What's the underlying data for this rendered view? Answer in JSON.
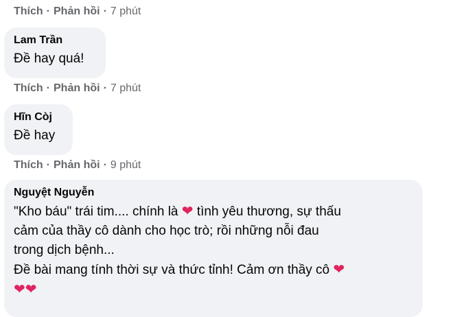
{
  "comments": [
    {
      "actions": {
        "like": "Thích",
        "reply": "Phản hồi",
        "time": "7 phút"
      }
    },
    {
      "author": "Lam Trần",
      "lines": [
        "Đề hay quá!"
      ],
      "actions": {
        "like": "Thích",
        "reply": "Phản hồi",
        "time": "7 phút"
      }
    },
    {
      "author": "Hĩn Còj",
      "lines": [
        "Đề hay"
      ],
      "actions": {
        "like": "Thích",
        "reply": "Phản hồi",
        "time": "9 phút"
      }
    },
    {
      "author": "Nguyệt Nguyễn",
      "line1_a": "\"Kho báu\" trái tim.... chính là",
      "line1_b": "tình yêu thương, sự thấu",
      "line2": "cảm của thầy cô dành cho học trò; rồi những nỗi đau",
      "line3": "trong dịch bệnh...",
      "line4": "Đề bài mang tính thời sự và thức tỉnh! Cảm ơn thầy cô",
      "heart": "❤"
    }
  ],
  "separator": "·",
  "colors": {
    "bubble": "#f0f2f5",
    "meta": "#65676b",
    "heart": "#e0245e"
  }
}
